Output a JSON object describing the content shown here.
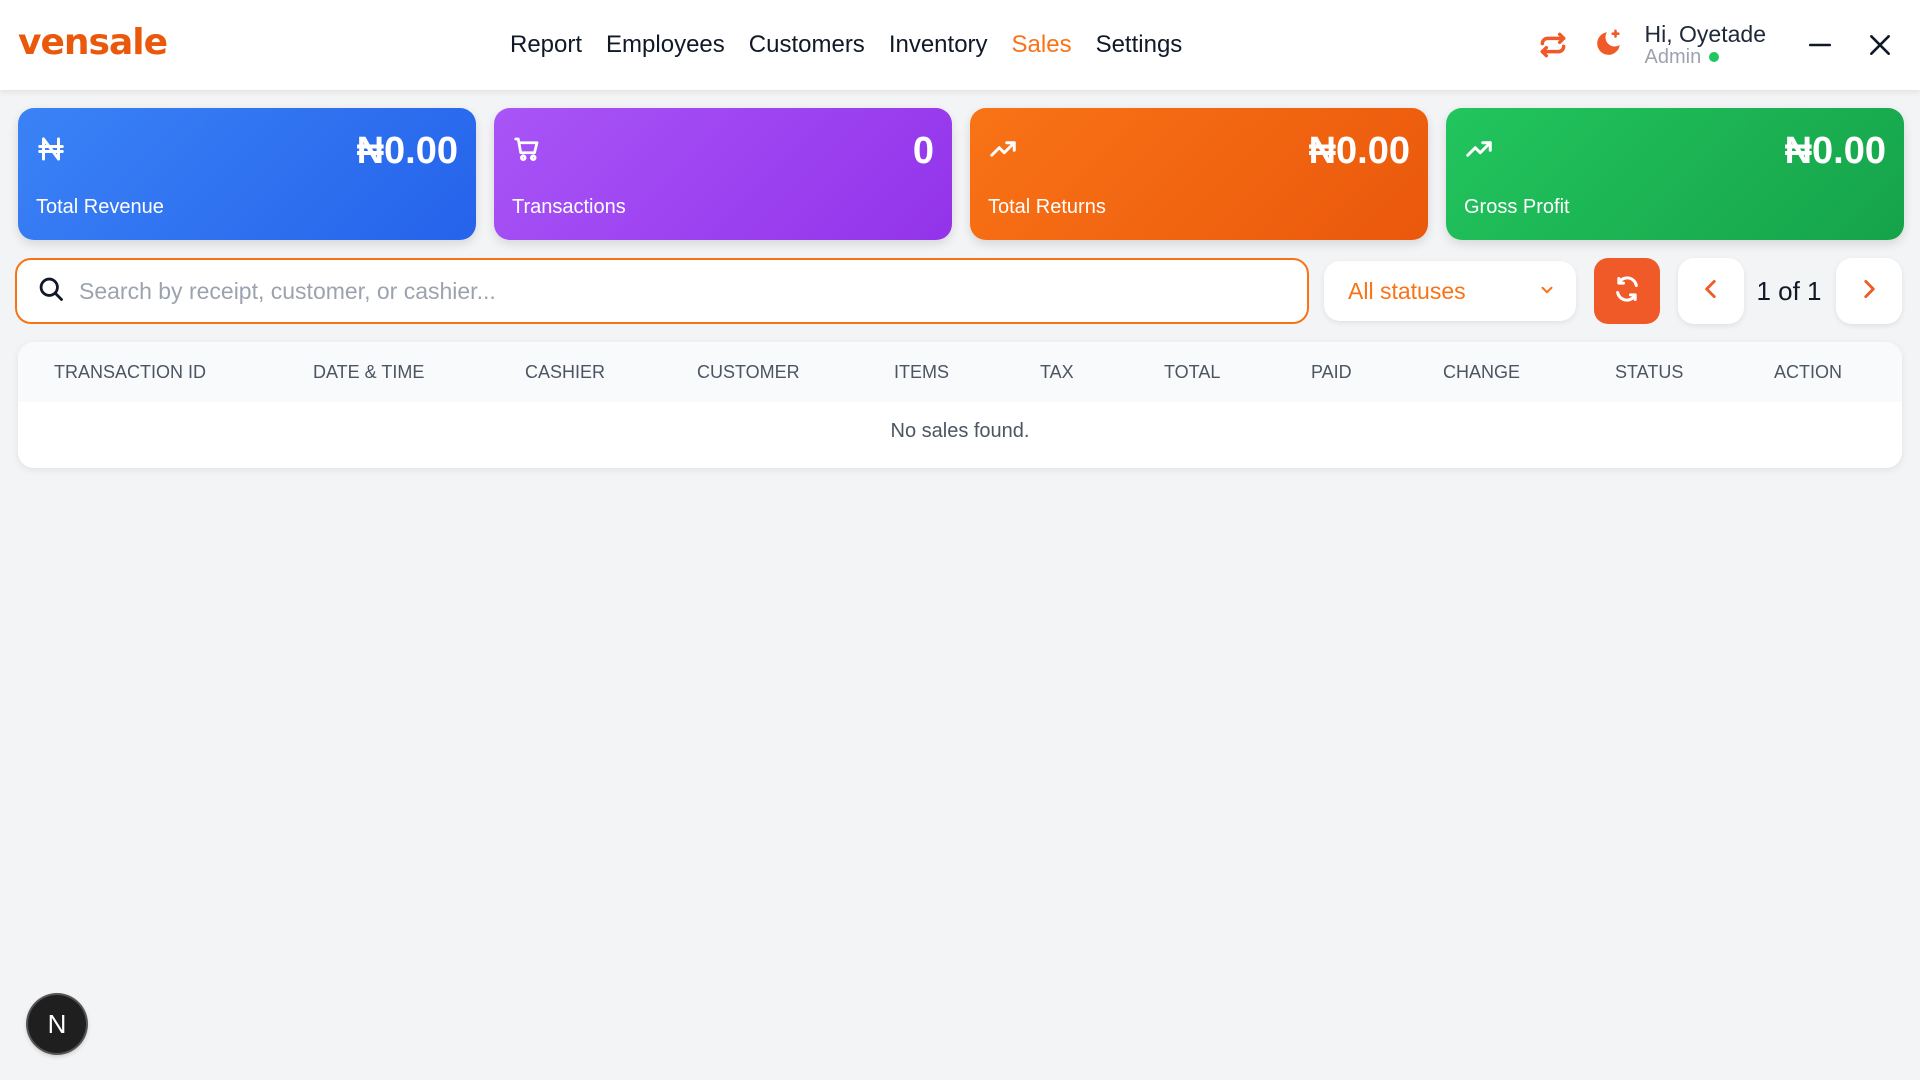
{
  "app": {
    "logo_text": "vensale"
  },
  "colors": {
    "brand": "#ea580c",
    "accent": "#f97316",
    "revenue_card": "#2563eb",
    "transactions_card": "#9333ea",
    "returns_card": "#ea580c",
    "profit_card": "#16a34a"
  },
  "nav": {
    "items": [
      {
        "label": "Report"
      },
      {
        "label": "Employees"
      },
      {
        "label": "Customers"
      },
      {
        "label": "Inventory"
      },
      {
        "label": "Sales",
        "active": true
      },
      {
        "label": "Settings"
      }
    ]
  },
  "user": {
    "greeting": "Hi, Oyetade",
    "role": "Admin",
    "status_icon": "online-dot"
  },
  "stats": [
    {
      "icon": "naira-icon",
      "value": "₦0.00",
      "label": "Total Revenue"
    },
    {
      "icon": "cart-icon",
      "value": "0",
      "label": "Transactions"
    },
    {
      "icon": "trending-up-icon",
      "value": "₦0.00",
      "label": "Total Returns"
    },
    {
      "icon": "trending-up-icon",
      "value": "₦0.00",
      "label": "Gross Profit"
    }
  ],
  "toolbar": {
    "search_placeholder": "Search by receipt, customer, or cashier...",
    "search_value": "",
    "status_filter": "All statuses",
    "pagination": "1 of 1"
  },
  "table": {
    "columns": [
      "TRANSACTION ID",
      "DATE & TIME",
      "CASHIER",
      "CUSTOMER",
      "ITEMS",
      "TAX",
      "TOTAL",
      "PAID",
      "CHANGE",
      "STATUS",
      "ACTION"
    ],
    "empty_message": "No sales found."
  },
  "badge": {
    "letter": "N"
  }
}
